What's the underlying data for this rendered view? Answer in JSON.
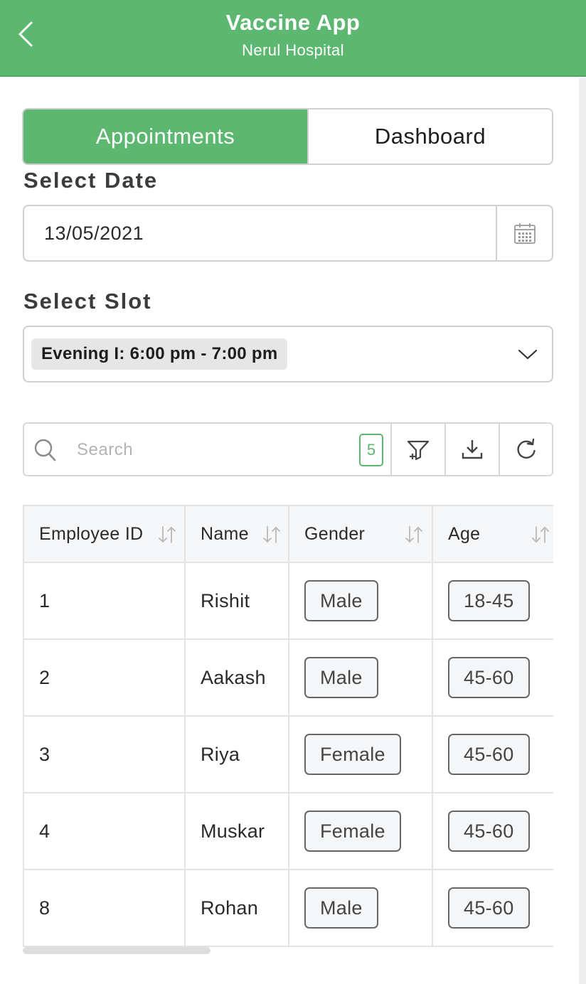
{
  "header": {
    "title": "Vaccine App",
    "subtitle": "Nerul Hospital",
    "back_icon": "chevron-left-icon"
  },
  "tabs": [
    {
      "label": "Appointments",
      "active": true
    },
    {
      "label": "Dashboard",
      "active": false
    }
  ],
  "date": {
    "label": "Select Date",
    "value": "13/05/2021",
    "icon": "calendar-icon"
  },
  "slot": {
    "label": "Select Slot",
    "value": "Evening I: 6:00 pm - 7:00 pm",
    "icon": "chevron-down-icon"
  },
  "toolbar": {
    "search_placeholder": "Search",
    "count": "5",
    "icons": [
      "search-icon",
      "filter-add-icon",
      "download-icon",
      "refresh-icon"
    ]
  },
  "table": {
    "columns": [
      "Employee ID",
      "Name",
      "Gender",
      "Age"
    ],
    "rows": [
      {
        "id": "1",
        "name": "Rishit",
        "gender": "Male",
        "age": "18-45"
      },
      {
        "id": "2",
        "name": "Aakash",
        "gender": "Male",
        "age": "45-60"
      },
      {
        "id": "3",
        "name": "Riya",
        "gender": "Female",
        "age": "45-60"
      },
      {
        "id": "4",
        "name": "Muskar",
        "gender": "Female",
        "age": "45-60"
      },
      {
        "id": "8",
        "name": "Rohan",
        "gender": "Male",
        "age": "45-60"
      }
    ]
  },
  "colors": {
    "accent": "#5cb870",
    "border": "#cfcfcf",
    "header_row_bg": "#f5f6f8"
  }
}
